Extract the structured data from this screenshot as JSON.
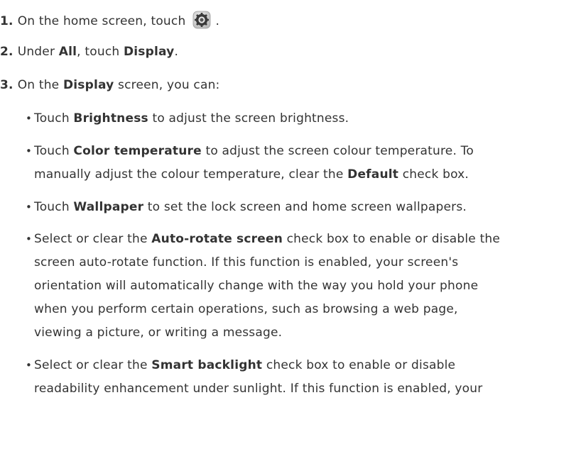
{
  "steps": [
    {
      "num": "1.",
      "text_before": "On the home screen, touch",
      "icon": "settings-icon",
      "text_after": "."
    },
    {
      "num": "2.",
      "before": "Under ",
      "b1": "All",
      "mid": ", touch ",
      "b2": "Display",
      "after": "."
    },
    {
      "num": "3.",
      "before": "On the ",
      "b1": "Display",
      "after": " screen, you can:"
    }
  ],
  "bullets": [
    {
      "lines": [
        {
          "before": "Touch ",
          "bold": "Brightness",
          "after": " to adjust the screen brightness."
        }
      ]
    },
    {
      "lines": [
        {
          "before": "Touch ",
          "bold": "Color temperature",
          "after": " to adjust the screen colour temperature. To"
        },
        {
          "before": "manually adjust the colour temperature, clear the ",
          "bold": "Default",
          "after": " check box."
        }
      ]
    },
    {
      "lines": [
        {
          "before": "Touch ",
          "bold": "Wallpaper",
          "after": " to set the lock screen and home screen wallpapers."
        }
      ]
    },
    {
      "lines": [
        {
          "before": "Select or clear the ",
          "bold": "Auto-rotate screen",
          "after": " check box to enable or disable the"
        },
        {
          "text": "screen auto-rotate function. If this function is enabled, your screen's"
        },
        {
          "text": "orientation will automatically change with the way you hold your phone"
        },
        {
          "text": "when you perform certain operations, such as browsing a web page,"
        },
        {
          "text": "viewing a picture, or writing a message."
        }
      ]
    },
    {
      "lines": [
        {
          "before": "Select or clear the ",
          "bold": "Smart backlight",
          "after": " check box to enable or disable"
        },
        {
          "text": "readability enhancement under sunlight. If this function is enabled, your"
        }
      ]
    }
  ],
  "bullet_glyph": "•"
}
